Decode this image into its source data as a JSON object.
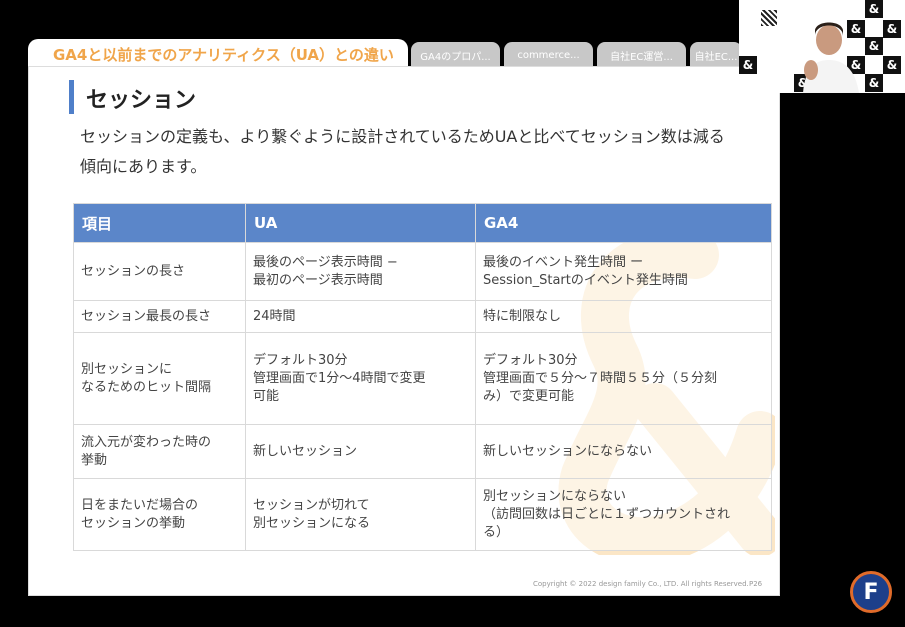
{
  "tabs": {
    "active": "GA4と以前までのアナリティクス（UA）との違い",
    "others": [
      "GA4のプロパ...",
      "commerce...",
      "自社EC運営...",
      "自社EC..."
    ]
  },
  "section": {
    "title": "セッション",
    "lead": "セッションの定義も、より繋ぐように設計されているためUAと比べてセッション数は減る傾向にあります。"
  },
  "table": {
    "headers": [
      "項目",
      "UA",
      "GA4"
    ],
    "rows": [
      [
        "セッションの長さ",
        "最後のページ表示時間 −\n最初のページ表示時間",
        "最後のイベント発生時間 ー\nSession_Startのイベント発生時間"
      ],
      [
        "セッション最長の長さ",
        "24時間",
        "特に制限なし"
      ],
      [
        "別セッションに\nなるためのヒット間隔",
        "デフォルト30分\n管理画面で1分〜4時間で変更\n可能",
        "デフォルト30分\n管理画面で５分〜７時間５５分（５分刻\nみ）で変更可能"
      ],
      [
        "流入元が変わった時の\n挙動",
        "新しいセッション",
        "新しいセッションにならない"
      ],
      [
        "日をまたいだ場合の\nセッションの挙動",
        "セッションが切れて\n別セッションになる",
        "別セッションにならない\n（訪問回数は日ごとに１ずつカウントされ\nる）"
      ]
    ]
  },
  "footer": {
    "copyright": "Copyright © 2022 design family Co., LTD. All rights Reserved.",
    "page": "P26"
  },
  "logo": {
    "letter": "F"
  },
  "colors": {
    "accent": "#f0a54a",
    "header": "#5b86c9"
  }
}
